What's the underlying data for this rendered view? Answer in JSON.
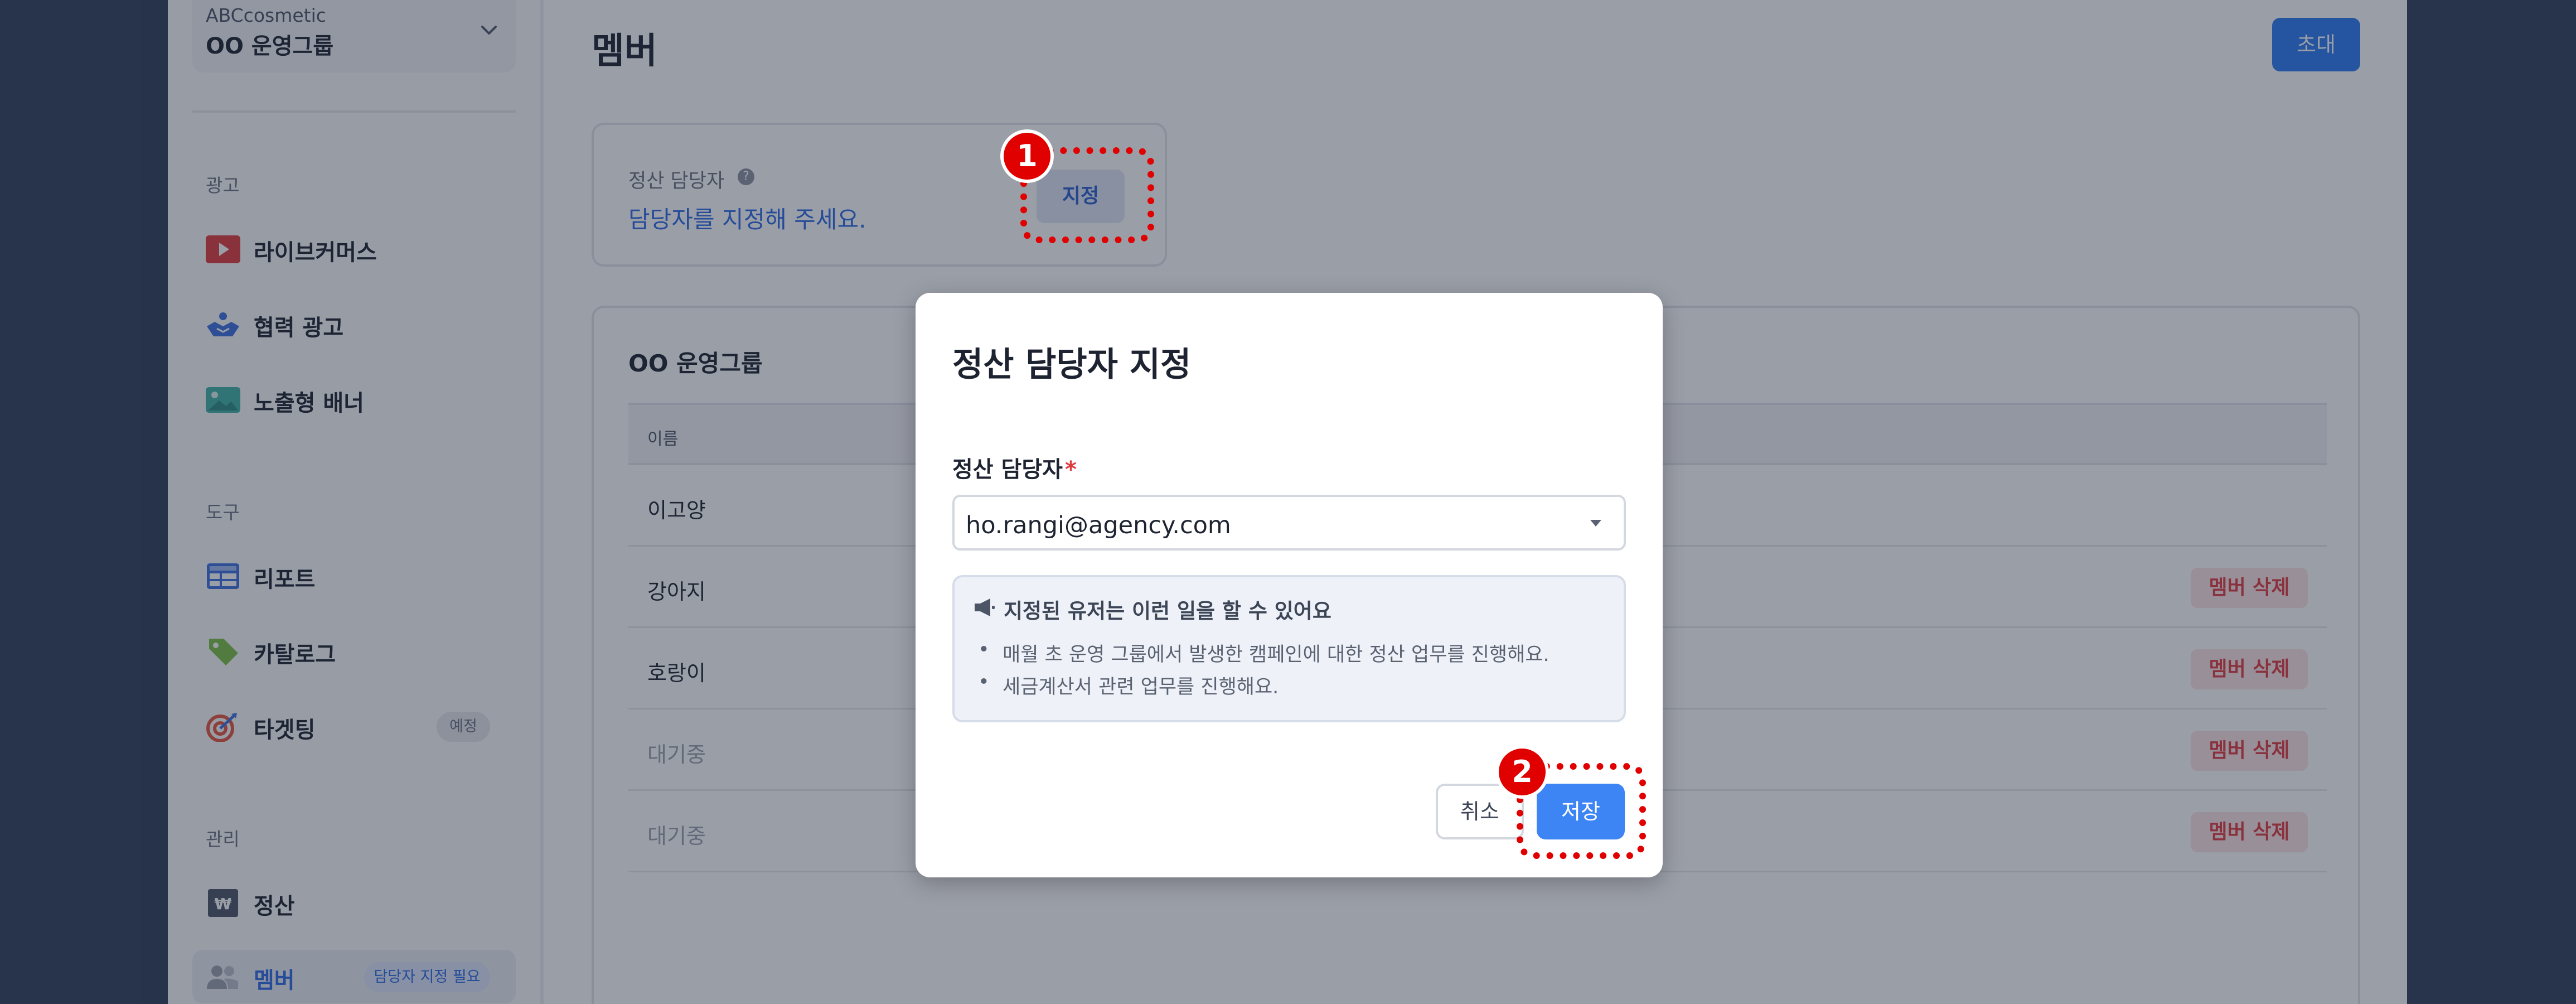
{
  "sidebar": {
    "org": {
      "company": "ABCcosmetic",
      "name": "OO 운영그룹"
    },
    "sections": [
      {
        "label": "광고",
        "items": [
          {
            "label": "라이브커머스",
            "icon": "play-icon"
          },
          {
            "label": "협력 광고",
            "icon": "handshake-icon"
          },
          {
            "label": "노출형 배너",
            "icon": "image-icon"
          }
        ]
      },
      {
        "label": "도구",
        "items": [
          {
            "label": "리포트",
            "icon": "table-icon"
          },
          {
            "label": "카탈로그",
            "icon": "tag-icon"
          },
          {
            "label": "타겟팅",
            "icon": "target-icon",
            "badge": "예정"
          }
        ]
      },
      {
        "label": "관리",
        "items": [
          {
            "label": "정산",
            "icon": "won-icon"
          },
          {
            "label": "멤버",
            "icon": "users-icon",
            "badge": "담당자 지정 필요",
            "active": true
          }
        ]
      }
    ]
  },
  "main": {
    "title": "멤버",
    "invite_label": "초대",
    "settlement": {
      "label": "정산 담당자",
      "help_glyph": "?",
      "hint": "담당자를 지정해 주세요.",
      "assign_label": "지정"
    },
    "group": {
      "title": "OO 운영그룹",
      "column_name": "이름",
      "rows": [
        {
          "name": "이고양",
          "pending": false,
          "delete_label": ""
        },
        {
          "name": "강아지",
          "pending": false,
          "delete_label": "멤버 삭제"
        },
        {
          "name": "호랑이",
          "pending": false,
          "delete_label": "멤버 삭제"
        },
        {
          "name": "대기중",
          "pending": true,
          "delete_label": "멤버 삭제"
        },
        {
          "name": "대기중",
          "pending": true,
          "delete_label": "멤버 삭제"
        }
      ]
    }
  },
  "modal": {
    "title": "정산 담당자 지정",
    "field_label": "정산 담당자",
    "required_mark": "*",
    "selected_value": "ho.rangi@agency.com",
    "info_title": "지정된 유저는 이런 일을 할 수 있어요",
    "info_items": [
      "매월 초 운영 그룹에서 발생한 캠페인에 대한 정산 업무를 진행해요.",
      "세금계산서 관련 업무를 진행해요."
    ],
    "cancel_label": "취소",
    "save_label": "저장"
  },
  "callouts": {
    "step1": "1",
    "step2": "2"
  },
  "colors": {
    "accent": "#2b7bf2",
    "danger": "#e0393e",
    "callout": "#e00000",
    "outer_bg": "#2f3d57"
  }
}
